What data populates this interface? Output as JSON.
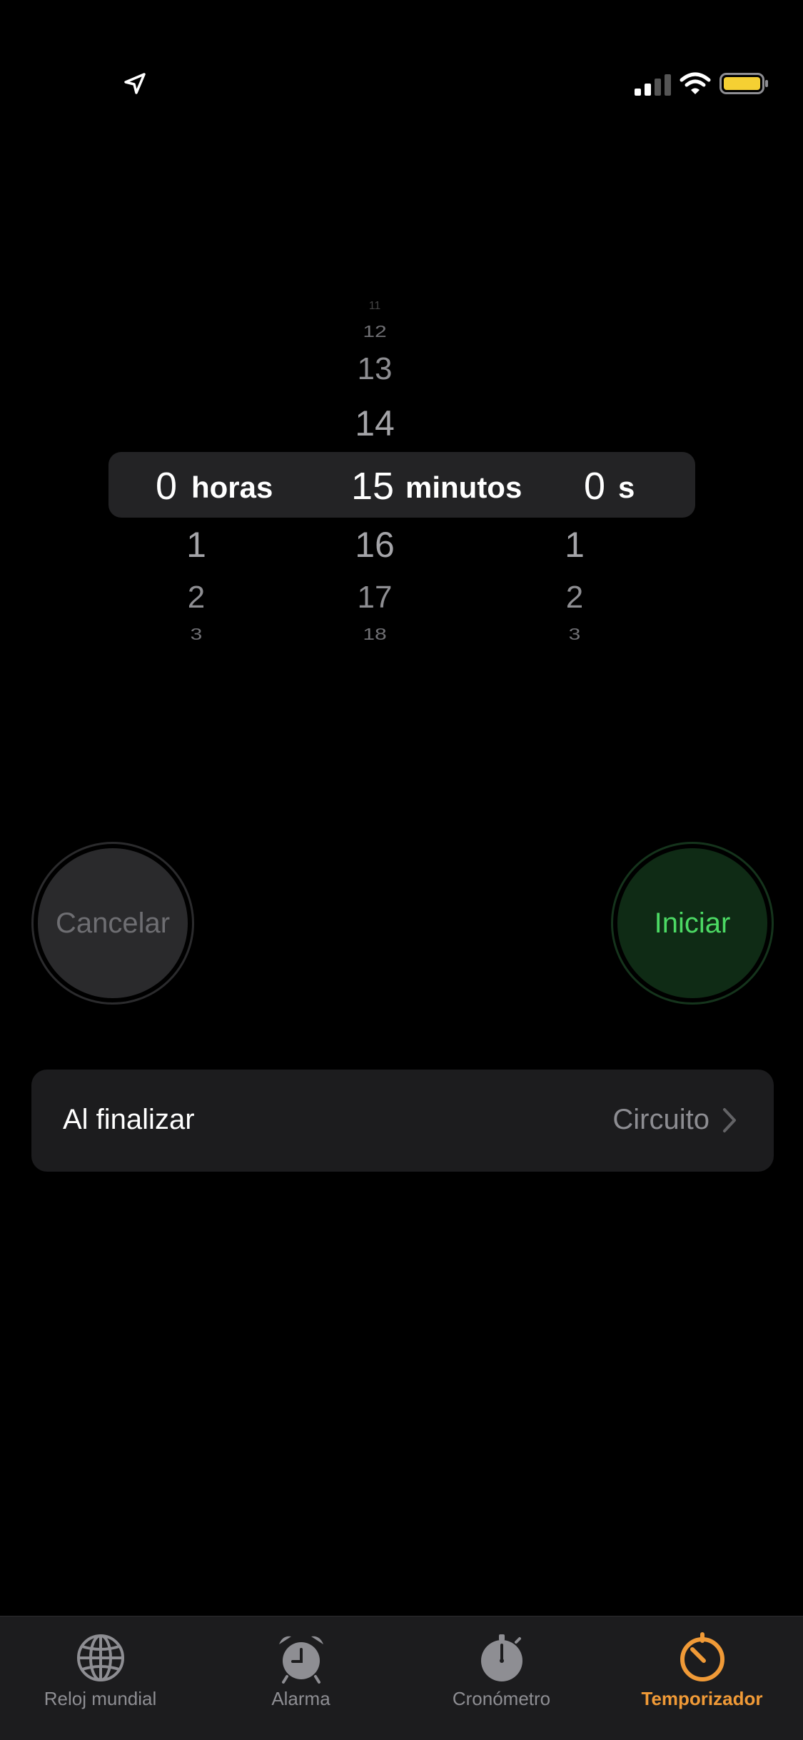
{
  "status_bar": {
    "icons": [
      "location-arrow-icon",
      "cellular-signal-icon",
      "wifi-icon",
      "battery-icon"
    ],
    "battery_color": "#f5d033"
  },
  "picker": {
    "hours": {
      "above": [],
      "selected": "0",
      "unit": "horas",
      "below": [
        "1",
        "2",
        "3"
      ]
    },
    "minutes": {
      "above": [
        "12",
        "13",
        "14"
      ],
      "selected": "15",
      "unit": "minutos",
      "below": [
        "16",
        "17",
        "18"
      ]
    },
    "seconds": {
      "above": [],
      "selected": "0",
      "unit": "s",
      "below": [
        "1",
        "2",
        "3"
      ]
    }
  },
  "buttons": {
    "cancel_label": "Cancelar",
    "start_label": "Iniciar",
    "start_color": "#4cd964"
  },
  "when_done": {
    "label": "Al finalizar",
    "value": "Circuito"
  },
  "tabbar": {
    "active_color": "#f09a37",
    "tabs": [
      {
        "label": "Reloj mundial",
        "icon": "globe-icon",
        "active": false
      },
      {
        "label": "Alarma",
        "icon": "alarm-clock-icon",
        "active": false
      },
      {
        "label": "Cronómetro",
        "icon": "stopwatch-icon",
        "active": false
      },
      {
        "label": "Temporizador",
        "icon": "timer-icon",
        "active": true
      }
    ]
  }
}
